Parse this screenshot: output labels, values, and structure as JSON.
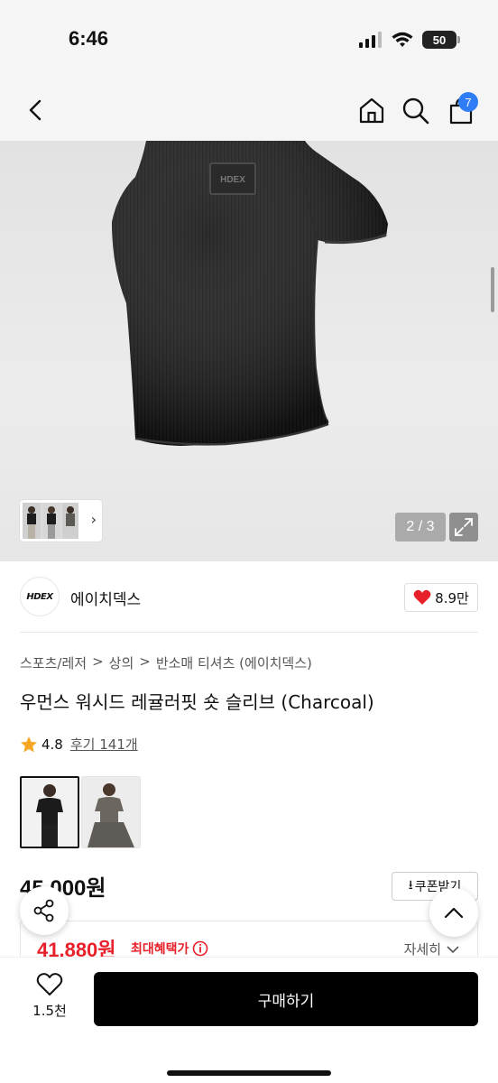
{
  "status": {
    "time": "6:46",
    "battery": "50"
  },
  "nav": {
    "cart_count": "7"
  },
  "gallery": {
    "counter": "2 / 3",
    "badge_text": "HDEX"
  },
  "brand": {
    "logo_text": "HDEX",
    "name": "에이치덱스",
    "likes": "8.9만"
  },
  "breadcrumb": [
    "스포츠/레저",
    "상의",
    "반소매 티셔츠 (에이치덱스)"
  ],
  "product": {
    "title": "우먼스 워시드 레귤러핏 숏 슬리브 (Charcoal)",
    "rating": "4.8",
    "reviews": "후기 141개",
    "price": "45,000원",
    "coupon_label": "쿠폰받기",
    "benefit_price": "41,880원",
    "benefit_label": "최대혜택가",
    "benefit_detail": "자세히"
  },
  "bottom": {
    "wish_count": "1.5천",
    "buy_label": "구매하기"
  },
  "colors": {
    "accent_red": "#e8202a",
    "badge_blue": "#2f7df6",
    "buy_black": "#000000"
  }
}
